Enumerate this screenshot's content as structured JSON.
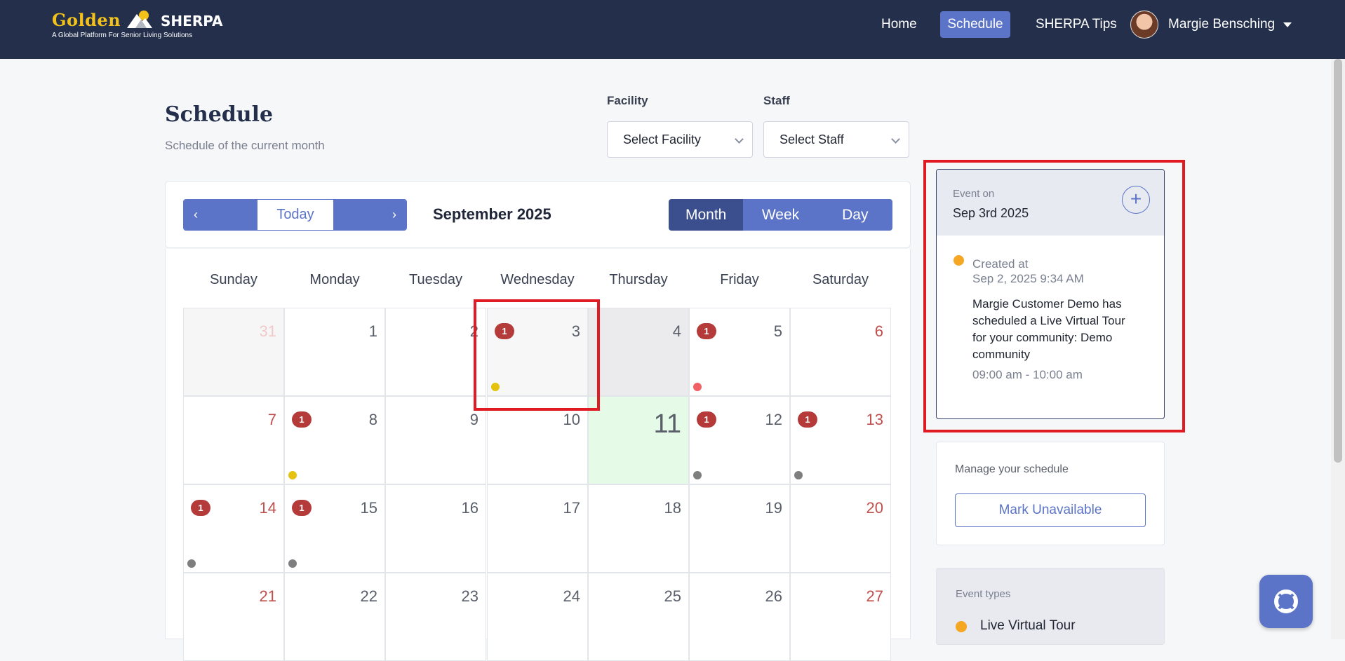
{
  "brand": {
    "name_part1": "Golden",
    "name_part2": "SHERPA",
    "tagline": "A Global Platform For Senior Living Solutions"
  },
  "nav": {
    "home": "Home",
    "schedule": "Schedule",
    "tips": "SHERPA Tips",
    "user_name": "Margie Bensching"
  },
  "header": {
    "title": "Schedule",
    "subtitle": "Schedule of the current month"
  },
  "filters": {
    "facility_label": "Facility",
    "facility_value": "Select Facility",
    "staff_label": "Staff",
    "staff_value": "Select Staff"
  },
  "toolbar": {
    "prev_icon": "‹",
    "today": "Today",
    "next_icon": "›",
    "month": "September 2025",
    "views": [
      "Month",
      "Week",
      "Day"
    ],
    "active_view": "Month"
  },
  "calendar": {
    "weekdays": [
      "Sunday",
      "Monday",
      "Tuesday",
      "Wednesday",
      "Thursday",
      "Friday",
      "Saturday"
    ],
    "weeks": [
      [
        {
          "day": "31",
          "other": true
        },
        {
          "day": "1"
        },
        {
          "day": "2"
        },
        {
          "day": "3",
          "badge": "1",
          "dot": "yellow",
          "state": "selected"
        },
        {
          "day": "4",
          "state": "shaded"
        },
        {
          "day": "5",
          "badge": "1",
          "dot": "red"
        },
        {
          "day": "6"
        }
      ],
      [
        {
          "day": "7"
        },
        {
          "day": "8",
          "badge": "1",
          "dot": "yellow"
        },
        {
          "day": "9"
        },
        {
          "day": "10"
        },
        {
          "day": "11",
          "state": "today"
        },
        {
          "day": "12",
          "badge": "1",
          "dot": "gray"
        },
        {
          "day": "13",
          "badge": "1",
          "dot": "gray"
        }
      ],
      [
        {
          "day": "14",
          "badge": "1",
          "dot": "gray"
        },
        {
          "day": "15",
          "badge": "1",
          "dot": "gray"
        },
        {
          "day": "16"
        },
        {
          "day": "17"
        },
        {
          "day": "18"
        },
        {
          "day": "19"
        },
        {
          "day": "20"
        }
      ],
      [
        {
          "day": "21"
        },
        {
          "day": "22"
        },
        {
          "day": "23"
        },
        {
          "day": "24"
        },
        {
          "day": "25"
        },
        {
          "day": "26"
        },
        {
          "day": "27"
        }
      ]
    ]
  },
  "event_panel": {
    "event_on_label": "Event on",
    "date": "Sep 3rd 2025",
    "created_label": "Created at",
    "created_value": "Sep 2, 2025 9:34 AM",
    "description": "Margie Customer Demo has scheduled a Live Virtual Tour for your community: Demo community",
    "time": "09:00 am - 10:00 am",
    "dot_color": "#f5a623"
  },
  "manage": {
    "title": "Manage your schedule",
    "button": "Mark Unavailable"
  },
  "event_types": {
    "title": "Event types",
    "items": [
      {
        "label": "Live Virtual Tour",
        "color": "#f5a623"
      }
    ]
  },
  "colors": {
    "nav_bg": "#232f4b",
    "accent": "#5b74c7",
    "badge": "#b53b3b",
    "highlight": "#e01b24",
    "today_bg": "#e5fbe7"
  }
}
